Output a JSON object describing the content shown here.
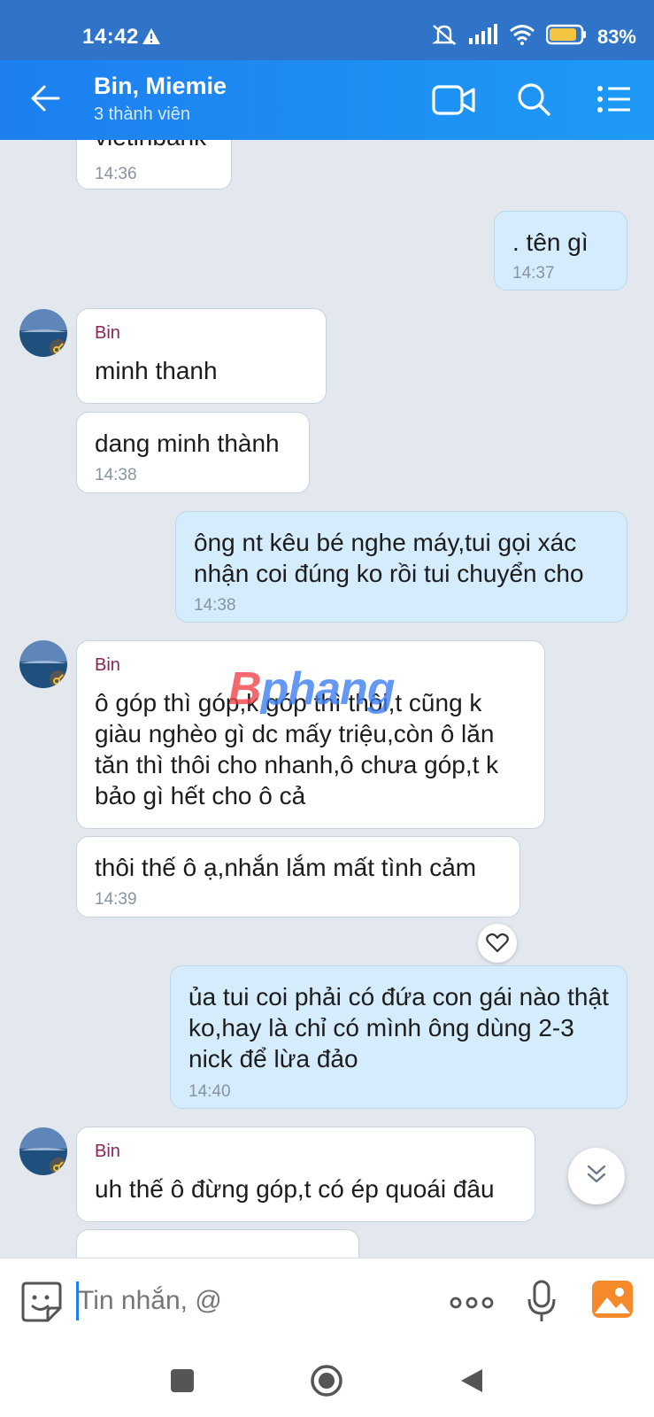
{
  "status_bar": {
    "time": "14:42",
    "battery": "83%",
    "icons": [
      "warning-icon",
      "mute-icon",
      "signal-icon",
      "wifi-icon",
      "battery-icon"
    ]
  },
  "header": {
    "title": "Bin, Miemie",
    "subtitle": "3 thành viên",
    "icons": [
      "back-arrow-icon",
      "video-call-icon",
      "search-icon",
      "menu-icon"
    ]
  },
  "messages": [
    {
      "dir": "in",
      "text": "vietinbank",
      "time": "14:36"
    },
    {
      "dir": "out",
      "text": ". tên gì",
      "time": "14:37"
    },
    {
      "dir": "in",
      "sender": "Bin",
      "text": "minh thanh"
    },
    {
      "dir": "in",
      "text": "dang minh thành",
      "time": "14:38"
    },
    {
      "dir": "out",
      "text": "ông nt kêu bé nghe máy,tui gọi xác nhận coi đúng ko rồi tui chuyển cho",
      "time": "14:38"
    },
    {
      "dir": "in",
      "sender": "Bin",
      "text": "ô góp thì góp,k góp thì thôi,t cũng k giàu nghèo gì dc mấy triệu,còn ô lăn tăn thì thôi cho nhanh,ô chưa góp,t k bảo gì hết cho ô cả"
    },
    {
      "dir": "in",
      "text": "thôi thế ô ạ,nhắn lắm mất tình cảm",
      "time": "14:39"
    },
    {
      "dir": "out",
      "text": "ủa tui coi phải có đứa con gái nào thật ko,hay là chỉ có mình ông dùng 2-3 nick để lừa đảo",
      "time": "14:40"
    },
    {
      "dir": "in",
      "sender": "Bin",
      "text": "uh thế ô đừng góp,t có ép quoái đâu"
    }
  ],
  "watermark": {
    "part1": "B",
    "part2": "phang"
  },
  "composer": {
    "placeholder": "Tin nhắn, @",
    "icons": [
      "sticker-icon",
      "more-icon",
      "microphone-icon",
      "gallery-icon"
    ]
  },
  "colors": {
    "header": "#1d7ff0",
    "outgoing": "#d4ecfc",
    "incoming": "#ffffff",
    "sender": "#8a2458"
  }
}
